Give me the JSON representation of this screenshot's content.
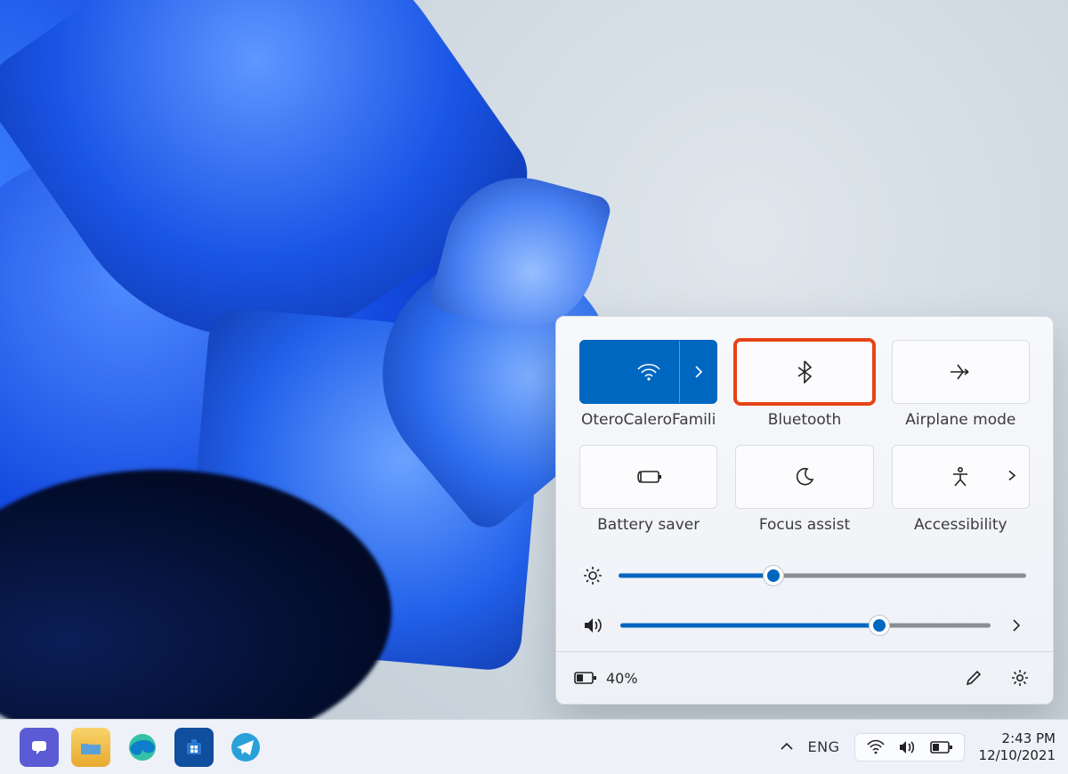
{
  "colors": {
    "accent": "#0067c0",
    "highlight": "#e64416"
  },
  "quick_settings": {
    "tiles": [
      {
        "key": "wifi",
        "label": "OteroCaleroFamili",
        "icon": "wifi-icon",
        "active": true,
        "has_split_chevron": true
      },
      {
        "key": "bluetooth",
        "label": "Bluetooth",
        "icon": "bluetooth-icon",
        "active": false,
        "highlighted": true
      },
      {
        "key": "airplane",
        "label": "Airplane mode",
        "icon": "airplane-icon",
        "active": false
      },
      {
        "key": "battery_saver",
        "label": "Battery saver",
        "icon": "battery-saver-icon",
        "active": false
      },
      {
        "key": "focus_assist",
        "label": "Focus assist",
        "icon": "moon-icon",
        "active": false
      },
      {
        "key": "accessibility",
        "label": "Accessibility",
        "icon": "accessibility-icon",
        "active": false,
        "has_inline_chevron": true
      }
    ],
    "brightness_pct": 38,
    "volume_pct": 70,
    "battery_text": "40%"
  },
  "taskbar": {
    "pinned": [
      {
        "name": "chat-app-icon",
        "bg": "#5b5bd6"
      },
      {
        "name": "file-explorer-icon",
        "bg": "#f6c445"
      },
      {
        "name": "edge-browser-icon",
        "bg": "#1a9fb3"
      },
      {
        "name": "microsoft-store-icon",
        "bg": "#1b66c9"
      },
      {
        "name": "telegram-icon",
        "bg": "#2aa0da"
      }
    ],
    "language": "ENG",
    "time": "2:43 PM",
    "date": "12/10/2021"
  }
}
